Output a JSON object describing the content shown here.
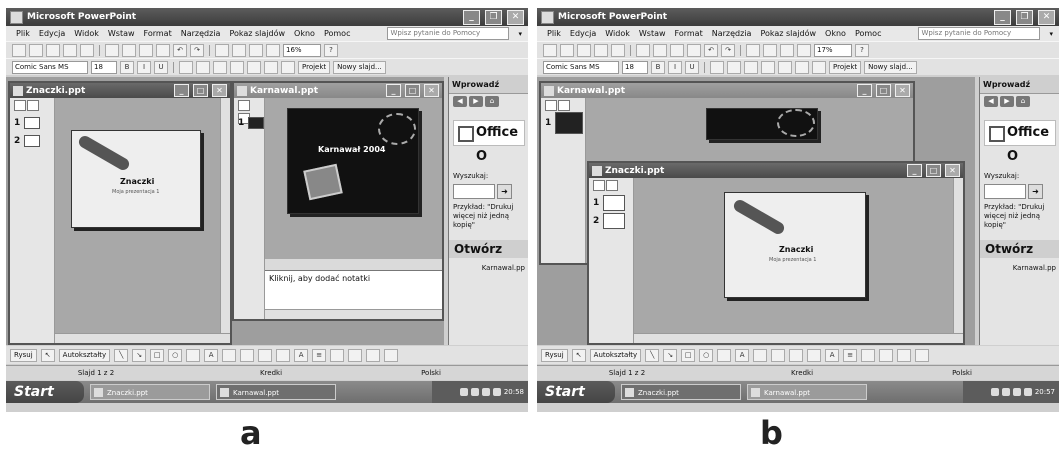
{
  "app_title": "Microsoft PowerPoint",
  "menu": [
    "Plik",
    "Edycja",
    "Widok",
    "Wstaw",
    "Format",
    "Narzędzia",
    "Pokaz slajdów",
    "Okno",
    "Pomoc"
  ],
  "help_placeholder": "Wpisz pytanie do Pomocy",
  "font_name": "Comic Sans MS",
  "font_size": "18",
  "toolbar_labels": {
    "bold": "B",
    "italic": "I",
    "underline": "U",
    "projekt": "Projekt",
    "nowy_slajd": "Nowy slajd..."
  },
  "drawbar": {
    "rysuj": "Rysuj",
    "autoksztalty": "Autokształty"
  },
  "status": {
    "slide": "Slajd 1 z 2",
    "template": "Kredki",
    "language": "Polski"
  },
  "taskbar": {
    "start": "Start",
    "items": [
      "Znaczki.ppt",
      "Karnawal.ppt"
    ]
  },
  "taskpane": {
    "header": "Wprowadź",
    "office_logo": "Office O",
    "search_label": "Wyszukaj:",
    "example": "Przykład: \"Drukuj więcej niż jedną kopię\"",
    "open": "Otwórz",
    "recent_file": "Karnawal.pp"
  },
  "panel_a": {
    "label": "a",
    "zoom": "16%",
    "clock": "20:58",
    "win1": {
      "title": "Znaczki.ppt",
      "slide_title": "Znaczki",
      "slide_sub": "Moja prezentacja 1"
    },
    "win2": {
      "title": "Karnawal.ppt",
      "slide_title": "Karnawał 2004",
      "notes": "Kliknij, aby dodać notatki"
    }
  },
  "panel_b": {
    "label": "b",
    "zoom": "17%",
    "clock": "20:57",
    "win_back": {
      "title": "Karnawal.ppt"
    },
    "win_front": {
      "title": "Znaczki.ppt",
      "slide_title": "Znaczki",
      "slide_sub": "Moja prezentacja 1"
    }
  }
}
